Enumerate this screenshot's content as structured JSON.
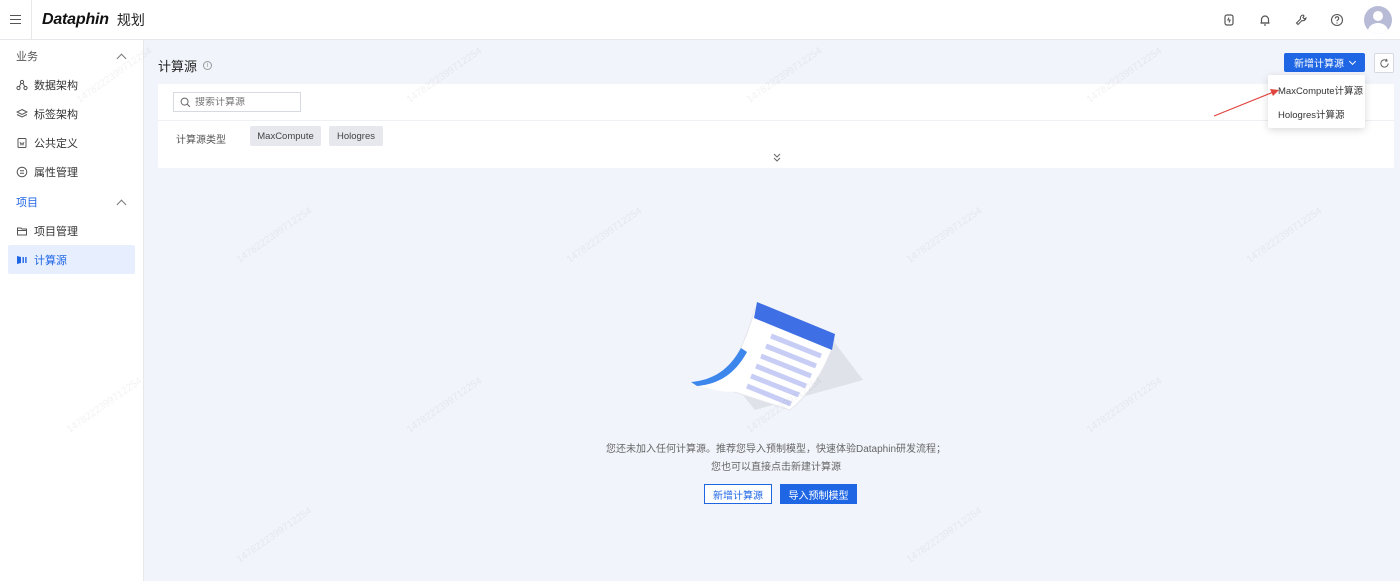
{
  "topbar": {
    "brand": "Dataphin",
    "module": "规划"
  },
  "sidebar": {
    "group1": "业务",
    "group1_items": [
      "数据架构",
      "标签架构",
      "公共定义",
      "属性管理"
    ],
    "group2": "项目",
    "group2_items": [
      "项目管理",
      "计算源"
    ]
  },
  "main": {
    "title": "计算源",
    "new_button": "新增计算源",
    "search_placeholder": "搜索计算源",
    "type_label": "计算源类型",
    "tags": [
      "MaxCompute",
      "Hologres"
    ],
    "dropdown": [
      "MaxCompute计算源",
      "Hologres计算源"
    ],
    "empty_line1": "您还未加入任何计算源。推荐您导入预制模型，快速体验Dataphin研发流程；",
    "empty_line2": "您也可以直接点击新建计算源",
    "btn_new": "新增计算源",
    "btn_import": "导入预制模型"
  },
  "colors": {
    "accent": "#1f66e5",
    "active_bg": "#e7efff",
    "page_bg": "#f1f4fa"
  },
  "watermark": "1478222399712254"
}
